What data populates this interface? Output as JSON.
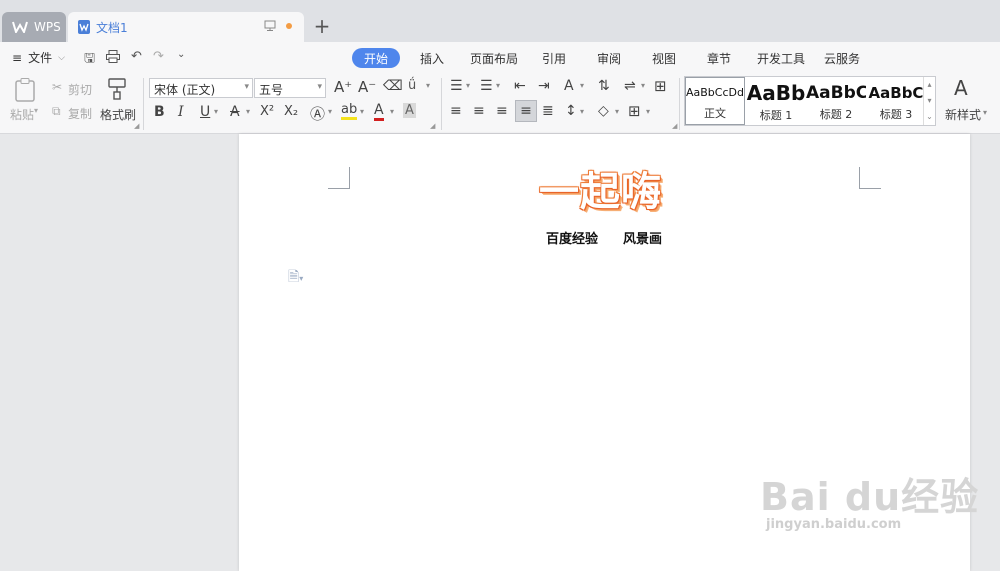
{
  "tabs": {
    "wps_label": "WPS",
    "doc_label": "文档1",
    "add_label": "+"
  },
  "menu": {
    "file_label": "文件",
    "items": [
      "开始",
      "插入",
      "页面布局",
      "引用",
      "审阅",
      "视图",
      "章节",
      "开发工具",
      "云服务"
    ]
  },
  "ribbon": {
    "paste": "粘贴",
    "cut": "剪切",
    "copy": "复制",
    "format_painter": "格式刷",
    "font_name": "宋体 (正文)",
    "font_size": "五号",
    "bold": "B",
    "italic": "I",
    "underline": "U",
    "strike": "A",
    "superscript": "X²",
    "subscript": "X₂",
    "styles": [
      {
        "preview": "AaBbCcDd",
        "label": "正文"
      },
      {
        "preview": "AaBb",
        "label": "标题 1"
      },
      {
        "preview": "AaBbC",
        "label": "标题 2"
      },
      {
        "preview": "AaBbC",
        "label": "标题 3"
      }
    ],
    "new_style": "新样式"
  },
  "document": {
    "art_title": "一起嗨",
    "subtitle_left": "百度经验",
    "subtitle_right": "风景画"
  },
  "watermark": {
    "line1": "Bai du经验",
    "line2": "jingyan.baidu.com"
  },
  "colors": {
    "accent": "#4f86ec",
    "art_orange": "#e8632a",
    "unsaved_dot": "#f39c44"
  }
}
